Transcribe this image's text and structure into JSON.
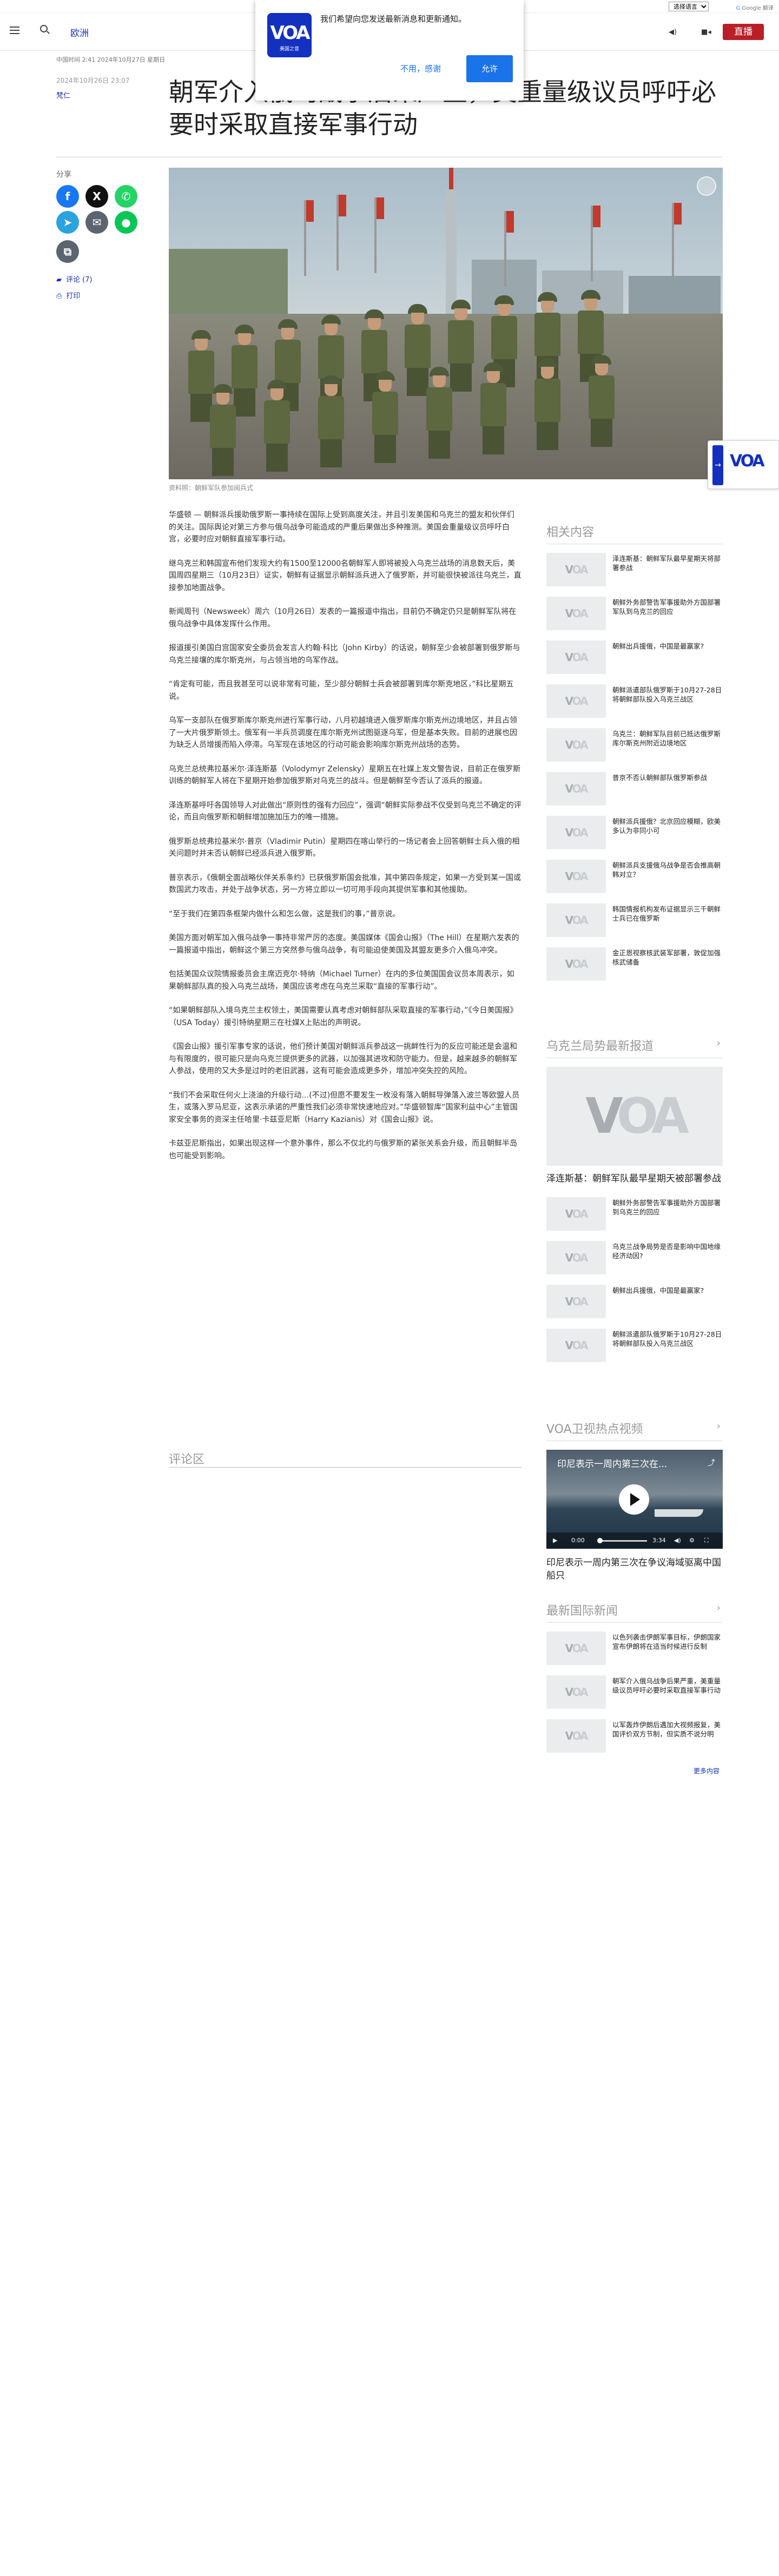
{
  "translate": {
    "select_label": "选择语言",
    "powered_by": "Google 翻译"
  },
  "header": {
    "section": "欧洲",
    "live": "直播"
  },
  "notification": {
    "message": "我们希望向您发送最新消息和更新通知。",
    "decline": "不用，感谢",
    "accept": "允许",
    "logo_text": "VOA",
    "logo_sub": "美国之音"
  },
  "article": {
    "meta": "中国时间 2:41 2024年10月27日 星期日",
    "date": "2024年10月26日 23:07",
    "author": "梵仁",
    "headline": "朝军介入俄乌战争后果严重，美重量级议员呼吁必要时采取直接军事行动",
    "caption": "资料照：朝鲜军队参加阅兵式",
    "paragraphs": [
      "华盛顿 — 朝鲜派兵援助俄罗斯一事持续在国际上受到高度关注，并且引发美国和乌克兰的盟友和伙伴们的关注。国际舆论对第三方参与俄乌战争可能造成的严重后果做出多种推测。美国会重量级议员呼吁白宫，必要时应对朝鲜直接军事行动。",
      "继乌克兰和韩国宣布他们发现大约有1500至12000名朝鲜军人即将被投入乌克兰战场的消息数天后，美国周四星期三（10月23日）证实，朝鲜有证据显示朝鲜派兵进入了俄罗斯，并可能很快被派往乌克兰，直接参加地面战争。",
      "新闻周刊（Newsweek）周六（10月26日）发表的一篇报道中指出，目前仍不确定仍只是朝鲜军队将在俄乌战争中具体发挥什么作用。",
      "报道援引美国白宫国家安全委员会发言人约翰·科比（John Kirby）的话说，朝鲜至少会被部署到俄罗斯与乌克兰接壤的库尔斯克州，与占领当地的乌军作战。",
      "“肯定有可能，而且我甚至可以说非常有可能，至少部分朝鲜士兵会被部署到库尔斯克地区，”科比星期五说。",
      "乌军一支部队在俄罗斯库尔斯克州进行军事行动，八月初越境进入俄罗斯库尔斯克州边境地区，并且占领了一大片俄罗斯领土。俄军有一半兵员调度在库尔斯克州试图驱逐乌军，但是基本失败。目前的进展也因为缺乏人员增援而陷入停滞。乌军现在该地区的行动可能会影响库尔斯克州战场的态势。",
      "乌克兰总统弗拉基米尔·泽连斯基（Volodymyr Zelensky）星期五在社媒上发文警告说，目前正在俄罗斯训练的朝鲜军人将在下星期开始参加俄罗斯对乌克兰的战斗。但是朝鲜至今否认了派兵的报道。",
      "泽连斯基呼吁各国领导人对此做出“原则性的强有力回应”，强调“朝鲜实际参战不仅受到乌克兰不确定的评论，而且向俄罗斯和朝鲜增加施加压力的唯一措施。",
      "俄罗斯总统弗拉基米尔·普京（Vladimir Putin）星期四在喀山举行的一场记者会上回答朝鲜士兵入俄的相关问题时并未否认朝鲜已经派兵进入俄罗斯。",
      "普京表示，《俄朝全面战略伙伴关系条约》已获俄罗斯国会批准，其中第四条规定，如果一方受到某一国或数国武力攻击，并处于战争状态，另一方将立即以一切可用手段向其提供军事和其他援助。",
      "“至于我们在第四条框架内做什么和怎么做，这是我们的事，”普京说。",
      "美国方面对朝军加入俄乌战争一事持非常严厉的态度。美国媒体《国会山报》（The Hill）在星期六发表的一篇报道中指出，朝鲜这个第三方突然参与俄乌战争，有可能迫使美国及其盟友更多介入俄乌冲突。",
      "包括美国众议院情报委员会主席迈克尔·特纳（Michael Turner）在内的多位美国国会议员本周表示，如果朝鲜部队真的投入乌克兰战场，美国应该考虑在乌克兰采取“直接的军事行动”。",
      "“如果朝鲜部队入境乌克兰主权领土，美国需要认真考虑对朝鲜部队采取直接的军事行动，”《今日美国报》（USA Today）援引特纳星期三在社媒X上贴出的声明说。",
      "《国会山报》援引军事专家的话说，他们预计美国对朝鲜派兵参战这一挑衅性行为的反应可能还是会温和与有限度的，很可能只是向乌克兰提供更多的武器，以加强其进攻和防守能力。但是，越来越多的朝鲜军人参战，使用的又大多是过时的老旧武器，这有可能会造成更多外，增加冲突失控的风险。",
      "“我们不会采取任何火上浇油的升级行动…(不过)但愿不要发生一枚没有落入朝鲜导弹落入波兰等欧盟人员生，或落入罗马尼亚，这表示承诺的严重性我们必须非常快速地应对。”华盛顿智库“国家利益中心”主管国家安全事务的资深主任哈里·卡兹亚尼斯（Harry Kazianis）对《国会山报》说。",
      "卡兹亚尼斯指出，如果出现这样一个意外事件，那么不仅北约与俄罗斯的紧张关系会升级，而且朝鲜半岛也可能受到影响。"
    ],
    "comments_heading": "评论区"
  },
  "share": {
    "label": "分享",
    "comments": "评论 (7)",
    "print": "打印"
  },
  "related": {
    "title": "相关内容",
    "items": [
      "泽连斯基：朝鲜军队最早星期天将部署参战",
      "朝鲜外务部警告军事援助外方国部署军队到乌克兰的回应",
      "朝鲜出兵援俄，中国是最赢家?",
      "朝鲜派遣部队俄罗斯于10月27-28日将朝鲜部队投入乌克兰战区",
      "乌克兰：朝鲜军队目前已抵达俄罗斯库尔斯克州附近边境地区",
      "普京不否认朝鲜部队俄罗斯参战",
      "朝鲜派兵援俄？北京回应模糊，欧美多认为非同小可",
      "朝鲜派兵支援俄乌战争是否会推高朝韩对立？",
      "韩国情报机构发布证据显示三千朝鲜士兵已在俄罗斯",
      "金正恩视察核武装军部署，敦促加强核武储备"
    ]
  },
  "ukraine": {
    "title": "乌克兰局势最新报道",
    "lead_title": "泽连斯基：朝鲜军队最早星期天被部署参战",
    "items": [
      "朝鲜外务部警告军事援助外方国部署到乌克兰的回应",
      "乌克兰战争局势是否是影响中国地缘经济动因?",
      "朝鲜出兵援俄，中国是最赢家?",
      "朝鲜派遣部队俄罗斯于10月27-28日将朝鲜部队投入乌克兰战区"
    ]
  },
  "video": {
    "title": "VOA卫视热点视频",
    "overlay_title": "印尼表示一周内第三次在...",
    "time_current": "0:00",
    "time_total": "3:34",
    "caption": "印尼表示一周内第三次在争议海域驱离中国船只"
  },
  "intl": {
    "title": "最新国际新闻",
    "items": [
      "以色列袭击伊朗军事目标，伊朗国家宣布伊朗将在适当时候进行反制",
      "朝军介入俄乌战争后果严重，美重量级议员呼吁必要时采取直接军事行动",
      "以军轰炸伊朗后遇加大视频报复，美国评价双方节制，但实质不说分明"
    ],
    "more": "更多内容"
  },
  "float_widget": {
    "logo": "VOA"
  }
}
